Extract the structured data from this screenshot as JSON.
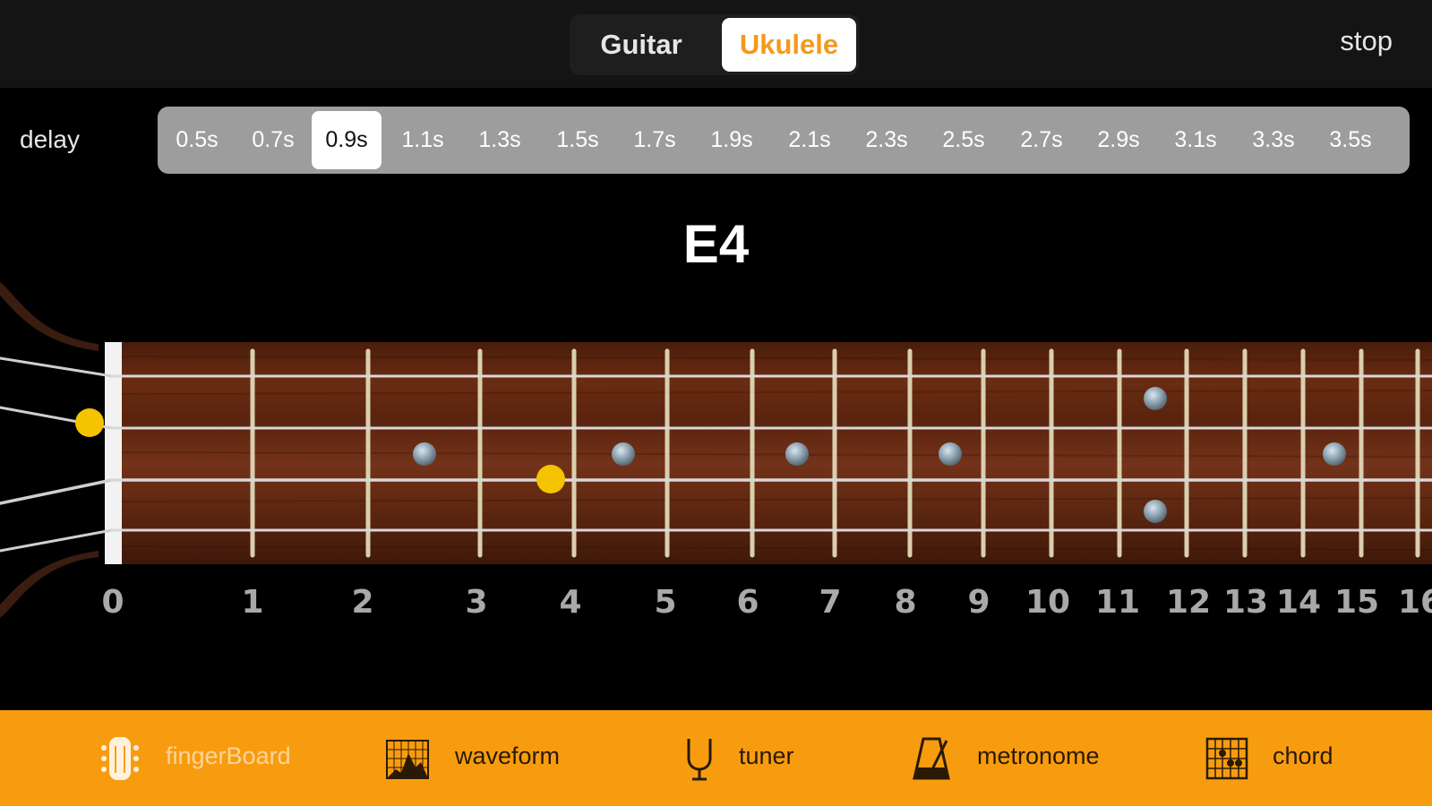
{
  "instrument_selector": {
    "options": [
      "Guitar",
      "Ukulele"
    ],
    "selected": "Ukulele"
  },
  "stop_label": "stop",
  "delay": {
    "label": "delay",
    "options": [
      "0.5s",
      "0.7s",
      "0.9s",
      "1.1s",
      "1.3s",
      "1.5s",
      "1.7s",
      "1.9s",
      "2.1s",
      "2.3s",
      "2.5s",
      "2.7s",
      "2.9s",
      "3.1s",
      "3.3s",
      "3.5s"
    ],
    "selected": "0.9s"
  },
  "current_note": "E4",
  "fretboard": {
    "fret_numbers": [
      "0",
      "1",
      "2",
      "3",
      "4",
      "5",
      "6",
      "7",
      "8",
      "9",
      "10",
      "11",
      "12",
      "13",
      "14",
      "15",
      "16"
    ],
    "highlight_color": "#f5c300",
    "highlighted_positions": [
      {
        "string": 2,
        "fret": 0
      },
      {
        "string": 3,
        "fret": 4
      }
    ]
  },
  "tabs": {
    "items": [
      {
        "label": "fingerBoard",
        "icon": "fingerboard-icon",
        "active": true
      },
      {
        "label": "waveform",
        "icon": "waveform-icon",
        "active": false
      },
      {
        "label": "tuner",
        "icon": "tuning-fork-icon",
        "active": false
      },
      {
        "label": "metronome",
        "icon": "metronome-icon",
        "active": false
      },
      {
        "label": "chord",
        "icon": "chord-grid-icon",
        "active": false
      }
    ],
    "accent_color": "#f89c0f"
  }
}
